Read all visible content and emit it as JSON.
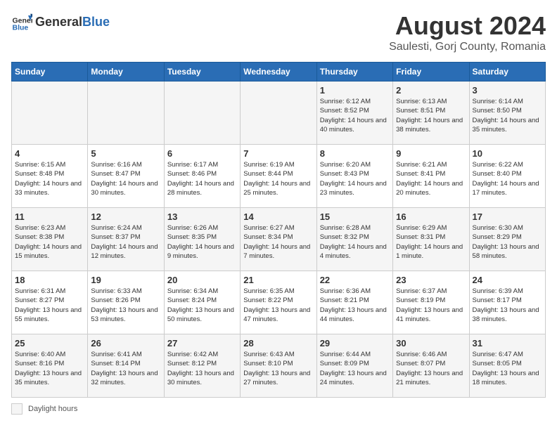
{
  "header": {
    "logo_general": "General",
    "logo_blue": "Blue",
    "title": "August 2024",
    "subtitle": "Saulesti, Gorj County, Romania"
  },
  "legend": {
    "box_label": "Daylight hours"
  },
  "days_of_week": [
    "Sunday",
    "Monday",
    "Tuesday",
    "Wednesday",
    "Thursday",
    "Friday",
    "Saturday"
  ],
  "weeks": [
    [
      {
        "day": "",
        "info": ""
      },
      {
        "day": "",
        "info": ""
      },
      {
        "day": "",
        "info": ""
      },
      {
        "day": "",
        "info": ""
      },
      {
        "day": "1",
        "info": "Sunrise: 6:12 AM\nSunset: 8:52 PM\nDaylight: 14 hours and 40 minutes."
      },
      {
        "day": "2",
        "info": "Sunrise: 6:13 AM\nSunset: 8:51 PM\nDaylight: 14 hours and 38 minutes."
      },
      {
        "day": "3",
        "info": "Sunrise: 6:14 AM\nSunset: 8:50 PM\nDaylight: 14 hours and 35 minutes."
      }
    ],
    [
      {
        "day": "4",
        "info": "Sunrise: 6:15 AM\nSunset: 8:48 PM\nDaylight: 14 hours and 33 minutes."
      },
      {
        "day": "5",
        "info": "Sunrise: 6:16 AM\nSunset: 8:47 PM\nDaylight: 14 hours and 30 minutes."
      },
      {
        "day": "6",
        "info": "Sunrise: 6:17 AM\nSunset: 8:46 PM\nDaylight: 14 hours and 28 minutes."
      },
      {
        "day": "7",
        "info": "Sunrise: 6:19 AM\nSunset: 8:44 PM\nDaylight: 14 hours and 25 minutes."
      },
      {
        "day": "8",
        "info": "Sunrise: 6:20 AM\nSunset: 8:43 PM\nDaylight: 14 hours and 23 minutes."
      },
      {
        "day": "9",
        "info": "Sunrise: 6:21 AM\nSunset: 8:41 PM\nDaylight: 14 hours and 20 minutes."
      },
      {
        "day": "10",
        "info": "Sunrise: 6:22 AM\nSunset: 8:40 PM\nDaylight: 14 hours and 17 minutes."
      }
    ],
    [
      {
        "day": "11",
        "info": "Sunrise: 6:23 AM\nSunset: 8:38 PM\nDaylight: 14 hours and 15 minutes."
      },
      {
        "day": "12",
        "info": "Sunrise: 6:24 AM\nSunset: 8:37 PM\nDaylight: 14 hours and 12 minutes."
      },
      {
        "day": "13",
        "info": "Sunrise: 6:26 AM\nSunset: 8:35 PM\nDaylight: 14 hours and 9 minutes."
      },
      {
        "day": "14",
        "info": "Sunrise: 6:27 AM\nSunset: 8:34 PM\nDaylight: 14 hours and 7 minutes."
      },
      {
        "day": "15",
        "info": "Sunrise: 6:28 AM\nSunset: 8:32 PM\nDaylight: 14 hours and 4 minutes."
      },
      {
        "day": "16",
        "info": "Sunrise: 6:29 AM\nSunset: 8:31 PM\nDaylight: 14 hours and 1 minute."
      },
      {
        "day": "17",
        "info": "Sunrise: 6:30 AM\nSunset: 8:29 PM\nDaylight: 13 hours and 58 minutes."
      }
    ],
    [
      {
        "day": "18",
        "info": "Sunrise: 6:31 AM\nSunset: 8:27 PM\nDaylight: 13 hours and 55 minutes."
      },
      {
        "day": "19",
        "info": "Sunrise: 6:33 AM\nSunset: 8:26 PM\nDaylight: 13 hours and 53 minutes."
      },
      {
        "day": "20",
        "info": "Sunrise: 6:34 AM\nSunset: 8:24 PM\nDaylight: 13 hours and 50 minutes."
      },
      {
        "day": "21",
        "info": "Sunrise: 6:35 AM\nSunset: 8:22 PM\nDaylight: 13 hours and 47 minutes."
      },
      {
        "day": "22",
        "info": "Sunrise: 6:36 AM\nSunset: 8:21 PM\nDaylight: 13 hours and 44 minutes."
      },
      {
        "day": "23",
        "info": "Sunrise: 6:37 AM\nSunset: 8:19 PM\nDaylight: 13 hours and 41 minutes."
      },
      {
        "day": "24",
        "info": "Sunrise: 6:39 AM\nSunset: 8:17 PM\nDaylight: 13 hours and 38 minutes."
      }
    ],
    [
      {
        "day": "25",
        "info": "Sunrise: 6:40 AM\nSunset: 8:16 PM\nDaylight: 13 hours and 35 minutes."
      },
      {
        "day": "26",
        "info": "Sunrise: 6:41 AM\nSunset: 8:14 PM\nDaylight: 13 hours and 32 minutes."
      },
      {
        "day": "27",
        "info": "Sunrise: 6:42 AM\nSunset: 8:12 PM\nDaylight: 13 hours and 30 minutes."
      },
      {
        "day": "28",
        "info": "Sunrise: 6:43 AM\nSunset: 8:10 PM\nDaylight: 13 hours and 27 minutes."
      },
      {
        "day": "29",
        "info": "Sunrise: 6:44 AM\nSunset: 8:09 PM\nDaylight: 13 hours and 24 minutes."
      },
      {
        "day": "30",
        "info": "Sunrise: 6:46 AM\nSunset: 8:07 PM\nDaylight: 13 hours and 21 minutes."
      },
      {
        "day": "31",
        "info": "Sunrise: 6:47 AM\nSunset: 8:05 PM\nDaylight: 13 hours and 18 minutes."
      }
    ]
  ]
}
